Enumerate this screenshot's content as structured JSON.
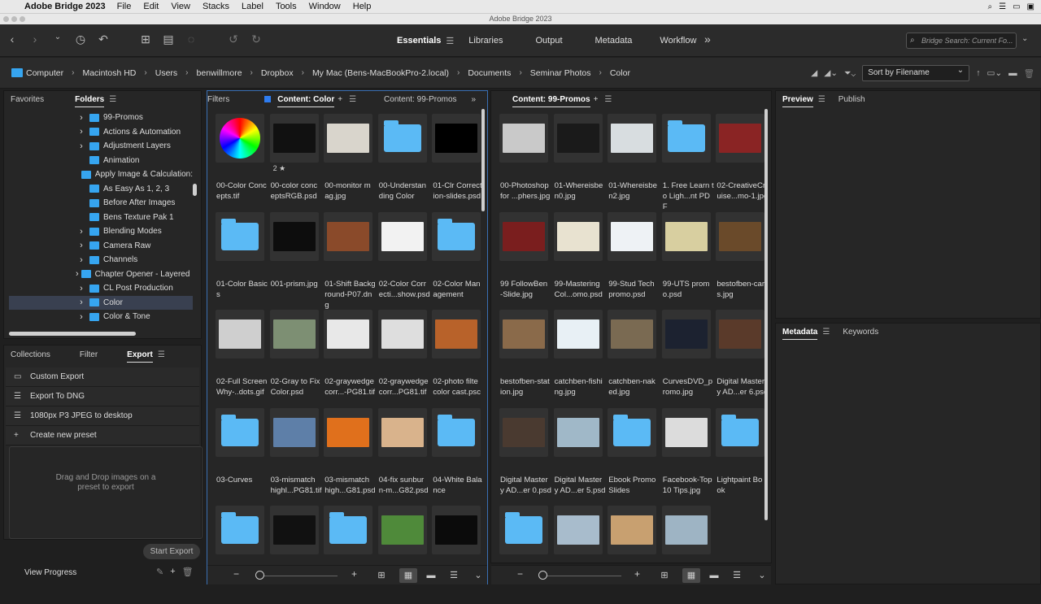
{
  "menubar": {
    "app": "Adobe Bridge 2023",
    "items": [
      "File",
      "Edit",
      "View",
      "Stacks",
      "Label",
      "Tools",
      "Window",
      "Help"
    ]
  },
  "window": {
    "title": "Adobe Bridge 2023"
  },
  "workspaces": {
    "items": [
      "Essentials",
      "Libraries",
      "Output",
      "Metadata",
      "Workflow"
    ],
    "active": "Essentials"
  },
  "search": {
    "placeholder": "Bridge Search: Current Fo..."
  },
  "path": [
    "Computer",
    "Macintosh HD",
    "Users",
    "benwillmore",
    "Dropbox",
    "My Mac (Bens-MacBookPro-2.local)",
    "Documents",
    "Seminar Photos",
    "Color"
  ],
  "sort": {
    "label": "Sort by Filename"
  },
  "left_tabs": {
    "favorites": "Favorites",
    "folders": "Folders"
  },
  "folders": [
    {
      "name": "99-Promos",
      "arrow": true
    },
    {
      "name": "Actions & Automation",
      "arrow": true
    },
    {
      "name": "Adjustment Layers",
      "arrow": true
    },
    {
      "name": "Animation",
      "arrow": false
    },
    {
      "name": "Apply Image & Calculation:",
      "arrow": false
    },
    {
      "name": "As Easy As 1, 2, 3",
      "arrow": false
    },
    {
      "name": "Before After Images",
      "arrow": false
    },
    {
      "name": "Bens Texture Pak 1",
      "arrow": false
    },
    {
      "name": "Blending Modes",
      "arrow": true
    },
    {
      "name": "Camera Raw",
      "arrow": true
    },
    {
      "name": "Channels",
      "arrow": true
    },
    {
      "name": "Chapter Opener - Layered I",
      "arrow": true
    },
    {
      "name": "CL Post Production",
      "arrow": true
    },
    {
      "name": "Color",
      "arrow": true,
      "selected": true
    },
    {
      "name": "Color & Tone",
      "arrow": true
    }
  ],
  "bottom_tabs": {
    "collections": "Collections",
    "filter": "Filter",
    "export": "Export"
  },
  "export_presets": [
    "Custom Export",
    "Export To DNG",
    "1080px P3 JPEG to desktop",
    "Create new preset"
  ],
  "dropzone": {
    "text": "Drag and Drop images on a\npreset to export"
  },
  "start_export": "Start Export",
  "view_progress": "View Progress",
  "filters_tab": "Filters",
  "content1": {
    "tab": "Content: Color",
    "tab2": "Content: 99-Promos"
  },
  "content2": {
    "tab": "Content: 99-Promos"
  },
  "preview": {
    "tab": "Preview",
    "publish": "Publish"
  },
  "metadata": {
    "tab": "Metadata",
    "keywords": "Keywords"
  },
  "grid1": [
    {
      "name": "00-Color Conc\nepts.tif",
      "kind": "wheel"
    },
    {
      "name": "00-color conc\neptsRGB.psd",
      "kind": "img",
      "color": "#111",
      "stars": "2 ★"
    },
    {
      "name": "00-monitor m\nag.jpg",
      "kind": "img",
      "color": "#d9d5cc"
    },
    {
      "name": "00-Understan\nding Color",
      "kind": "folder"
    },
    {
      "name": "01-Clr Correct\nion-slides.psd",
      "kind": "img",
      "color": "#000"
    },
    {
      "name": "01-Color Basic\ns",
      "kind": "folder"
    },
    {
      "name": "001-prism.jpg",
      "kind": "img",
      "color": "#0d0d0d"
    },
    {
      "name": "01-Shift Backg\nround-P07.dng",
      "kind": "img",
      "color": "#8a4a2a"
    },
    {
      "name": "02-Color Corr\necti...show.psd",
      "kind": "img",
      "color": "#f2f2f2"
    },
    {
      "name": "02-Color Man\nagement",
      "kind": "folder"
    },
    {
      "name": "02-Full Screen\nWhy-..dots.gif",
      "kind": "img",
      "color": "#cfcfcf"
    },
    {
      "name": "02-Gray to Fix\nColor.psd",
      "kind": "img",
      "color": "#7d8f73"
    },
    {
      "name": "02-graywedge\ncorr...-PG81.tif",
      "kind": "img",
      "color": "#e8e8e8"
    },
    {
      "name": "02-graywedge\ncorr...PG81.tif",
      "kind": "img",
      "color": "#dedede"
    },
    {
      "name": "02-photo filte\ncolor cast.psc",
      "kind": "img",
      "color": "#b8622a"
    },
    {
      "name": "03-Curves",
      "kind": "folder"
    },
    {
      "name": "03-mismatch\nhighl...PG81.tif",
      "kind": "img",
      "color": "#5e7fa8"
    },
    {
      "name": "03-mismatch\nhigh...G81.psd",
      "kind": "img",
      "color": "#e0701c"
    },
    {
      "name": "04-fix sunbur\nn-m...G82.psd",
      "kind": "img",
      "color": "#d9b38c"
    },
    {
      "name": "04-White Bala\nnce",
      "kind": "folder"
    },
    {
      "name": "",
      "kind": "folder"
    },
    {
      "name": "",
      "kind": "img",
      "color": "#111"
    },
    {
      "name": "",
      "kind": "folder"
    },
    {
      "name": "",
      "kind": "img",
      "color": "#4f8a3a"
    },
    {
      "name": "",
      "kind": "img",
      "color": "#0b0b0b"
    }
  ],
  "grid2": [
    {
      "name": "00-Photoshop\nfor ...phers.jpg",
      "kind": "img",
      "color": "#c9c9c9"
    },
    {
      "name": "01-Whereisbe\nn0.jpg",
      "kind": "img",
      "color": "#1a1a1a"
    },
    {
      "name": "01-Whereisbe\nn2.jpg",
      "kind": "img",
      "color": "#d8dde0"
    },
    {
      "name": "1. Free Learn t\no Ligh...nt PDF",
      "kind": "folder"
    },
    {
      "name": "02-CreativeCr\nuise...mo-1.jpg",
      "kind": "img",
      "color": "#8a2424"
    },
    {
      "name": "99 FollowBen\n-Slide.jpg",
      "kind": "img",
      "color": "#7a1e1e"
    },
    {
      "name": "99-Mastering\nCol...omo.psd",
      "kind": "img",
      "color": "#e8e2d0"
    },
    {
      "name": "99-Stud Tech\npromo.psd",
      "kind": "img",
      "color": "#eef2f5"
    },
    {
      "name": "99-UTS prom\no.psd",
      "kind": "img",
      "color": "#d8cfa0"
    },
    {
      "name": "bestofben-car\ns.jpg",
      "kind": "img",
      "color": "#6a4a2a"
    },
    {
      "name": "bestofben-stat\nion.jpg",
      "kind": "img",
      "color": "#8a6a4a"
    },
    {
      "name": "catchben-fishi\nng.jpg",
      "kind": "img",
      "color": "#e8f0f5"
    },
    {
      "name": "catchben-nak\ned.jpg",
      "kind": "img",
      "color": "#7a6a52"
    },
    {
      "name": "CurvesDVD_p\nromo.jpg",
      "kind": "img",
      "color": "#1c2230"
    },
    {
      "name": "Digital Master\ny AD...er 6.psd",
      "kind": "img",
      "color": "#5a3a2a"
    },
    {
      "name": "Digital Master\ny AD...er 0.psd",
      "kind": "img",
      "color": "#4a3a30"
    },
    {
      "name": "Digital Master\ny AD...er 5.psd",
      "kind": "img",
      "color": "#a0b8c8"
    },
    {
      "name": "Ebook Promo\nSlides",
      "kind": "folder"
    },
    {
      "name": "Facebook-Top\n10 Tips.jpg",
      "kind": "img",
      "color": "#dcdcdc"
    },
    {
      "name": "Lightpaint Bo\nok",
      "kind": "folder"
    },
    {
      "name": "",
      "kind": "folder"
    },
    {
      "name": "",
      "kind": "img",
      "color": "#a8bccc"
    },
    {
      "name": "",
      "kind": "img",
      "color": "#c8a070"
    },
    {
      "name": "",
      "kind": "img",
      "color": "#9eb4c4"
    }
  ]
}
